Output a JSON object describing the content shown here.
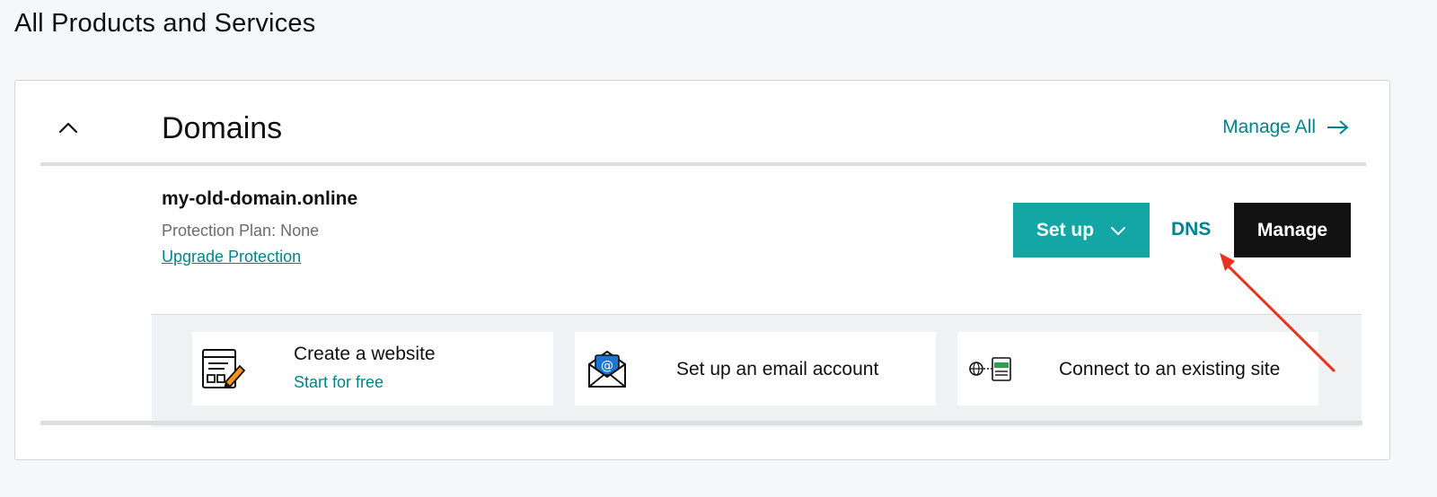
{
  "page": {
    "title": "All Products and Services"
  },
  "section": {
    "title": "Domains",
    "manage_all_label": "Manage All"
  },
  "domain": {
    "name": "my-old-domain.online",
    "protection": "Protection Plan: None",
    "upgrade_label": "Upgrade Protection",
    "setup_label": "Set up",
    "dns_label": "DNS",
    "manage_label": "Manage"
  },
  "suggestions": [
    {
      "title": "Create a website",
      "subtitle": "Start for free",
      "icon": "website-builder-icon"
    },
    {
      "title": "Set up an email account",
      "icon": "email-envelope-icon"
    },
    {
      "title": "Connect to an existing site",
      "icon": "connect-site-icon"
    }
  ],
  "colors": {
    "accent": "#00838c",
    "setup_button": "#14a5a5",
    "manage_button": "#111111",
    "annotation_arrow": "#e8341c",
    "page_background": "#f5f7f8"
  }
}
